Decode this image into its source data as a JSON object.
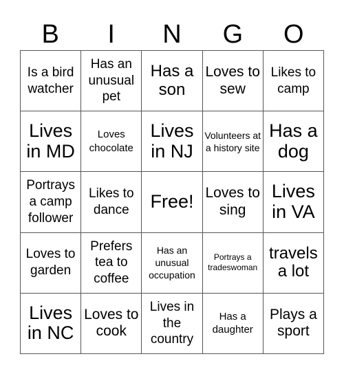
{
  "header": [
    "B",
    "I",
    "N",
    "G",
    "O"
  ],
  "cells": [
    {
      "text": "Is a bird watcher",
      "size": "s4"
    },
    {
      "text": "Has an unusual pet",
      "size": "s4"
    },
    {
      "text": "Has a son",
      "size": "s2"
    },
    {
      "text": "Loves to sew",
      "size": "s3"
    },
    {
      "text": "Likes to camp",
      "size": "s4"
    },
    {
      "text": "Lives in MD",
      "size": "s1"
    },
    {
      "text": "Loves chocolate",
      "size": "s5"
    },
    {
      "text": "Lives in NJ",
      "size": "s1"
    },
    {
      "text": "Volunteers at a history site",
      "size": "s6"
    },
    {
      "text": "Has a dog",
      "size": "s1"
    },
    {
      "text": "Portrays a camp follower",
      "size": "s4"
    },
    {
      "text": "Likes to dance",
      "size": "s4"
    },
    {
      "text": "Free!",
      "size": "s1"
    },
    {
      "text": "Loves to sing",
      "size": "s3"
    },
    {
      "text": "Lives in VA",
      "size": "s1"
    },
    {
      "text": "Loves to garden",
      "size": "s4"
    },
    {
      "text": "Prefers tea to coffee",
      "size": "s4"
    },
    {
      "text": "Has an unusual occupation",
      "size": "s6"
    },
    {
      "text": "Portrays a tradeswoman",
      "size": "s7"
    },
    {
      "text": "travels a lot",
      "size": "s2"
    },
    {
      "text": "Lives in NC",
      "size": "s1"
    },
    {
      "text": "Loves to cook",
      "size": "s3"
    },
    {
      "text": "Lives in the country",
      "size": "s4"
    },
    {
      "text": "Has a daughter",
      "size": "s5"
    },
    {
      "text": "Plays a sport",
      "size": "s3"
    }
  ]
}
